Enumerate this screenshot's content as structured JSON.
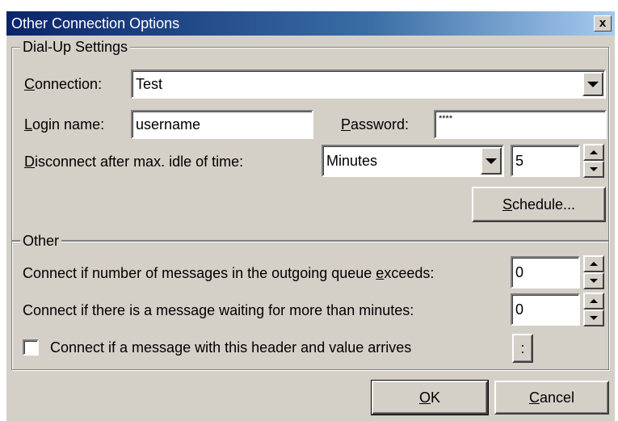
{
  "dialog": {
    "title": "Other Connection Options",
    "close_label": "x"
  },
  "dialup": {
    "group_label": "Dial-Up Settings",
    "connection_label_u": "C",
    "connection_label_rest": "onnection:",
    "connection_value": "Test",
    "login_label_u": "L",
    "login_label_rest": "ogin name:",
    "login_value": "username",
    "password_label_u": "P",
    "password_label_rest": "assword:",
    "password_value": "****",
    "idle_label_u": "D",
    "idle_label_rest": "isconnect after max. idle of time:",
    "idle_unit_value": "Minutes",
    "idle_amount_value": "5",
    "schedule_button_u": "S",
    "schedule_button_rest": "chedule..."
  },
  "other": {
    "group_label": "Other",
    "queue_label_pre": "Connect if number of messages in the outgoing queue ",
    "queue_label_u": "e",
    "queue_label_post": "xceeds:",
    "queue_value": "0",
    "waiting_label": "Connect if there is a message waiting for more than minutes:",
    "waiting_value": "0",
    "header_checkbox_label": "Connect if a message with this header and value arrives",
    "header_checkbox_checked": false,
    "header_button_label": ":"
  },
  "footer": {
    "ok_u": "O",
    "ok_rest": "K",
    "cancel_u": "C",
    "cancel_rest": "ancel"
  }
}
